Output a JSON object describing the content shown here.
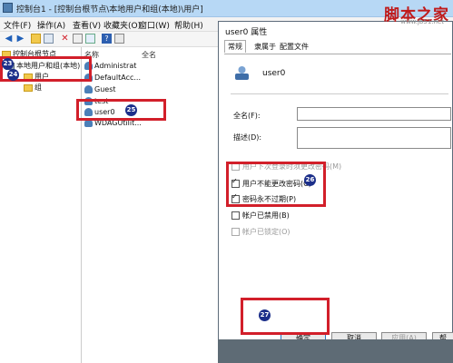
{
  "window": {
    "title": "控制台1 - [控制台根节点\\本地用户和组(本地)\\用户]"
  },
  "menu": [
    "文件(F)",
    "操作(A)",
    "查看(V)",
    "收藏夹(O)",
    "窗口(W)",
    "帮助(H)"
  ],
  "toolbar": {
    "icons": [
      "back-icon",
      "forward-icon",
      "up-folder-icon",
      "tree-icon",
      "delete-icon",
      "properties-icon",
      "export-icon",
      "help-icon",
      "view-icon"
    ]
  },
  "tree": {
    "root": "控制台根节点",
    "node": "本地用户和组(本地)",
    "users": "用户",
    "groups": "组"
  },
  "list": {
    "col_name": "名称",
    "col_fullname": "全名",
    "items": [
      "Administrat",
      "DefaultAcc...",
      "Guest",
      "test",
      "user0",
      "WDAGUtilit..."
    ]
  },
  "badges": {
    "b23": "23",
    "b24": "24",
    "b25": "25",
    "b26": "26",
    "b27": "27"
  },
  "dialog": {
    "title": "user0 属性",
    "tabs": [
      "常规",
      "隶属于",
      "配置文件"
    ],
    "username": "user0",
    "fullname_label": "全名(F):",
    "description_label": "描述(D):",
    "checkboxes": [
      {
        "label": "用户下次登录时须更改密码(M)",
        "checked": false,
        "disabled": true
      },
      {
        "label": "用户不能更改密码(C)",
        "checked": true,
        "disabled": false
      },
      {
        "label": "密码永不过期(P)",
        "checked": true,
        "disabled": false
      },
      {
        "label": "帐户已禁用(B)",
        "checked": false,
        "disabled": false
      },
      {
        "label": "帐户已锁定(O)",
        "checked": false,
        "disabled": true
      }
    ],
    "buttons": {
      "ok": "确定",
      "cancel": "取消",
      "apply": "应用(A)",
      "help": "帮"
    }
  },
  "watermark": {
    "text": "脚本之家",
    "url": "www.jb51.net"
  },
  "colors": {
    "highlight": "#d21f2a",
    "badge": "#1c2f8a"
  }
}
